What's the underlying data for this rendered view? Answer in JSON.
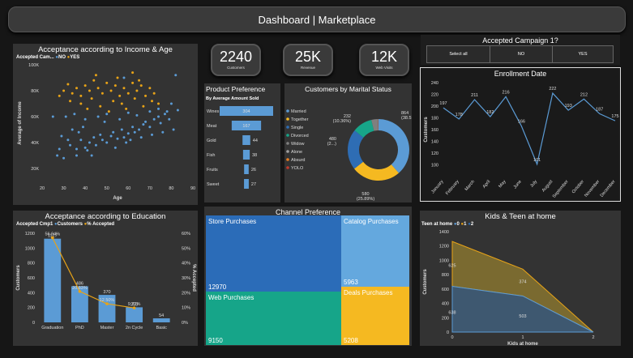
{
  "header": {
    "title": "Dashboard | Marketplace"
  },
  "kpis": [
    {
      "value": "2240",
      "caption": "Customers"
    },
    {
      "value": "25K",
      "caption": "Revenue"
    },
    {
      "value": "12K",
      "caption": "Web Visits"
    }
  ],
  "income_panel": {
    "title": "Acceptance according to Income & Age",
    "legend_label": "Accepted Cam...",
    "legend_no": "NO",
    "legend_yes": "YES",
    "colors": {
      "no": "#5b9bd5",
      "yes": "#e8a317"
    }
  },
  "product_panel": {
    "title": "Product Preference",
    "subtitle": "By Average Amount Sold"
  },
  "marital_panel": {
    "title": "Customers by Marital Status"
  },
  "campaign_slicer": {
    "title": "Accepted Campaign 1?",
    "options": [
      "Select all",
      "NO",
      "YES"
    ]
  },
  "enrollment_panel": {
    "title": "Enrollment Date"
  },
  "education_panel": {
    "title": "Acceptance according to Education",
    "legend_label": "Accepted Cmp1",
    "legend_customers": "Customers",
    "legend_accepted": "% Accepted"
  },
  "channel_panel": {
    "title": "Channel Preference",
    "tiles": [
      {
        "name": "Store Purchases",
        "value": "12970"
      },
      {
        "name": "Catalog Purchases",
        "value": "5963"
      },
      {
        "name": "Web Purchases",
        "value": "9150"
      },
      {
        "name": "Deals Purchases",
        "value": "5208"
      }
    ]
  },
  "kids_panel": {
    "title": "Kids & Teen at home",
    "legend_label": "Teen at home",
    "legend_items": [
      "0",
      "1",
      "2"
    ]
  },
  "chart_data": [
    {
      "type": "scatter",
      "title": "Acceptance according to Income & Age",
      "xlabel": "Age",
      "ylabel": "Average of Income",
      "xlim": [
        20,
        90
      ],
      "ylim": [
        10000,
        100000
      ],
      "x_ticks": [
        "20",
        "30",
        "40",
        "50",
        "60",
        "70",
        "80",
        "90"
      ],
      "y_ticks": [
        "20K",
        "40K",
        "60K",
        "80K",
        "100K"
      ],
      "series": [
        {
          "name": "NO",
          "points": [
            [
              27,
              30000
            ],
            [
              30,
              28000
            ],
            [
              33,
              38000
            ],
            [
              36,
              35000
            ],
            [
              38,
              42000
            ],
            [
              40,
              36000
            ],
            [
              42,
              40000
            ],
            [
              44,
              44000
            ],
            [
              45,
              38000
            ],
            [
              47,
              46000
            ],
            [
              48,
              42000
            ],
            [
              50,
              40000
            ],
            [
              52,
              45000
            ],
            [
              53,
              48000
            ],
            [
              55,
              43000
            ],
            [
              57,
              50000
            ],
            [
              58,
              44000
            ],
            [
              60,
              47000
            ],
            [
              62,
              52000
            ],
            [
              63,
              48000
            ],
            [
              65,
              50000
            ],
            [
              67,
              54000
            ],
            [
              68,
              56000
            ],
            [
              70,
              52000
            ],
            [
              72,
              58000
            ],
            [
              74,
              60000
            ],
            [
              75,
              55000
            ],
            [
              77,
              62000
            ],
            [
              78,
              64000
            ],
            [
              80,
              70000
            ],
            [
              82,
              92000
            ],
            [
              31,
              60000
            ],
            [
              35,
              62000
            ],
            [
              40,
              58000
            ],
            [
              46,
              60000
            ],
            [
              50,
              62000
            ],
            [
              56,
              58000
            ],
            [
              60,
              63000
            ],
            [
              64,
              61000
            ],
            [
              70,
              64000
            ],
            [
              74,
              66000
            ],
            [
              29,
              45000
            ],
            [
              34,
              50000
            ],
            [
              39,
              52000
            ],
            [
              43,
              30000
            ],
            [
              49,
              56000
            ],
            [
              54,
              36000
            ],
            [
              59,
              40000
            ],
            [
              66,
              44000
            ],
            [
              71,
              46000
            ],
            [
              76,
              48000
            ],
            [
              81,
              50000
            ],
            [
              25,
              60000
            ],
            [
              28,
              35000
            ],
            [
              32,
              42000
            ],
            [
              37,
              48000
            ],
            [
              41,
              34000
            ],
            [
              58,
              90000
            ],
            [
              79,
              58000
            ],
            [
              83,
              65000
            ],
            [
              36,
              30000
            ],
            [
              61,
              42000
            ]
          ]
        },
        {
          "name": "YES",
          "points": [
            [
              30,
              80000
            ],
            [
              32,
              85000
            ],
            [
              34,
              78000
            ],
            [
              36,
              82000
            ],
            [
              38,
              76000
            ],
            [
              40,
              84000
            ],
            [
              42,
              80000
            ],
            [
              44,
              88000
            ],
            [
              46,
              82000
            ],
            [
              48,
              78000
            ],
            [
              50,
              86000
            ],
            [
              52,
              80000
            ],
            [
              54,
              84000
            ],
            [
              56,
              76000
            ],
            [
              58,
              82000
            ],
            [
              60,
              78000
            ],
            [
              62,
              86000
            ],
            [
              64,
              80000
            ],
            [
              66,
              84000
            ],
            [
              68,
              76000
            ],
            [
              70,
              82000
            ],
            [
              72,
              78000
            ],
            [
              33,
              72000
            ],
            [
              38,
              70000
            ],
            [
              43,
              74000
            ],
            [
              47,
              68000
            ],
            [
              53,
              72000
            ],
            [
              57,
              70000
            ],
            [
              63,
              74000
            ],
            [
              67,
              68000
            ],
            [
              71,
              72000
            ],
            [
              45,
              92000
            ],
            [
              55,
              90000
            ],
            [
              62,
              94000
            ],
            [
              74,
              70000
            ],
            [
              28,
              76000
            ],
            [
              41,
              66000
            ],
            [
              51,
              64000
            ],
            [
              59,
              66000
            ],
            [
              65,
              88000
            ]
          ]
        }
      ]
    },
    {
      "type": "bar",
      "orientation": "horizontal",
      "title": "Product Preference",
      "subtitle": "By Average Amount Sold",
      "categories": [
        "Wines",
        "Meat",
        "Gold",
        "Fish",
        "Fruits",
        "Sweet"
      ],
      "values": [
        304,
        167,
        44,
        38,
        26,
        27
      ]
    },
    {
      "type": "pie",
      "variant": "donut",
      "title": "Customers by Marital Status",
      "categories": [
        "Married",
        "Together",
        "Single",
        "Divorced",
        "Widow",
        "Alone",
        "Absurd",
        "YOLO"
      ],
      "values": [
        864,
        580,
        480,
        232,
        77,
        3,
        2,
        2
      ],
      "labels": [
        "864 (38.57%)",
        "580 (25.89%)",
        "480 (2...)",
        "232 (10.36%)"
      ],
      "colors": [
        "#5b9bd5",
        "#f5b921",
        "#2e6db4",
        "#17a589",
        "#7f7f7f",
        "#a0a0a0",
        "#e67e22",
        "#c0392b"
      ]
    },
    {
      "type": "line",
      "title": "Enrollment Date",
      "xlabel": "",
      "ylabel": "Customers",
      "categories": [
        "January",
        "February",
        "March",
        "April",
        "May",
        "June",
        "July",
        "August",
        "September",
        "October",
        "November",
        "December"
      ],
      "values": [
        197,
        178,
        211,
        182,
        216,
        166,
        101,
        222,
        193,
        212,
        187,
        175
      ],
      "ylim": [
        80,
        240
      ],
      "y_ticks": [
        "100",
        "120",
        "140",
        "160",
        "180",
        "200",
        "220",
        "240"
      ]
    },
    {
      "type": "bar",
      "title": "Acceptance according to Education",
      "ylabel": "Customers",
      "y2label": "% Accepted",
      "categories": [
        "Graduation",
        "PhD",
        "Master",
        "2n Cycle",
        "Basic"
      ],
      "series": [
        {
          "name": "Customers",
          "values": [
            1127,
            486,
            370,
            203,
            54
          ]
        },
        {
          "name": "% Accepted",
          "values": [
            56.94,
            20.83,
            12.5,
            9.72,
            0
          ]
        }
      ],
      "labels": [
        "1127",
        "486",
        "370",
        "203",
        "54"
      ],
      "pct_labels": [
        "56.94%",
        "20.83%",
        "12.50%",
        "9.72%"
      ],
      "ylim": [
        0,
        1200
      ],
      "y_ticks": [
        "0",
        "200",
        "400",
        "600",
        "800",
        "1000",
        "1200"
      ],
      "y2_ticks": [
        "0%",
        "10%",
        "20%",
        "30%",
        "40%",
        "50%",
        "60%"
      ]
    },
    {
      "type": "area",
      "title": "Kids & Teen at home",
      "xlabel": "Kids at home",
      "ylabel": "Customers",
      "x": [
        0,
        1,
        2
      ],
      "series": [
        {
          "name": "0",
          "values": [
            638,
            503,
            0
          ]
        },
        {
          "name": "1",
          "values": [
            625,
            374,
            0
          ]
        }
      ],
      "labels": [
        "625",
        "638",
        "374",
        "503"
      ],
      "ylim": [
        0,
        1400
      ],
      "y_ticks": [
        "0",
        "200",
        "400",
        "600",
        "800",
        "1000",
        "1200",
        "1400"
      ],
      "colors": [
        "#5b9bd5",
        "#e8a317",
        "#2e6db4"
      ]
    }
  ]
}
